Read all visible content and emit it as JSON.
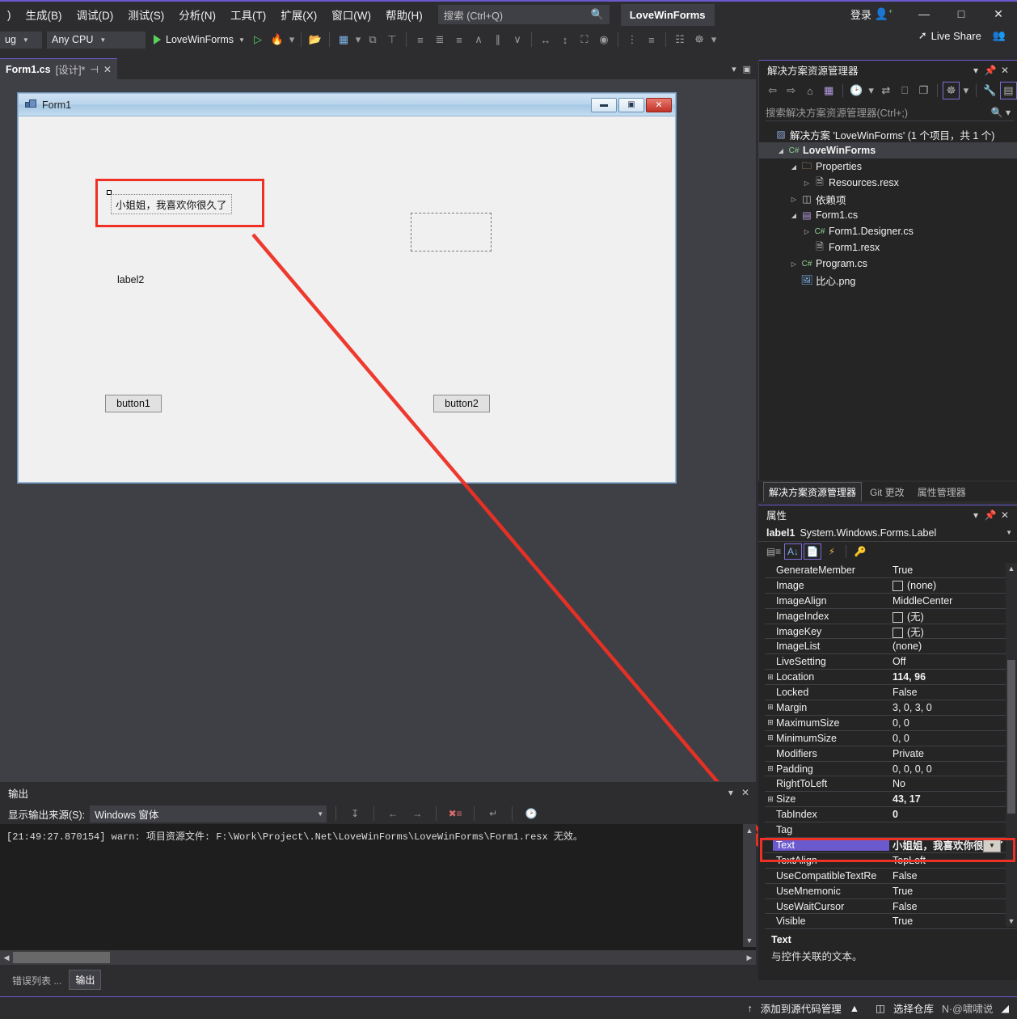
{
  "menubar": {
    "items": [
      {
        "label": ")"
      },
      {
        "label": "生成(B)"
      },
      {
        "label": "调试(D)"
      },
      {
        "label": "测试(S)"
      },
      {
        "label": "分析(N)"
      },
      {
        "label": "工具(T)"
      },
      {
        "label": "扩展(X)"
      },
      {
        "label": "窗口(W)"
      },
      {
        "label": "帮助(H)"
      }
    ],
    "search_placeholder": "搜索 (Ctrl+Q)",
    "project_chip": "LoveWinForms",
    "login_label": "登录",
    "minimize": "—",
    "maximize": "□",
    "close": "✕"
  },
  "toolbar": {
    "config": "ug",
    "platform": "Any CPU",
    "run_target": "LoveWinForms",
    "live_share": "Live Share"
  },
  "document_tab": {
    "name": "Form1.cs",
    "suffix": "[设计]*",
    "pin": "⊣",
    "close": "✕"
  },
  "designer": {
    "form_title": "Form1",
    "minimize": "▬",
    "maximize": "▣",
    "close": "✕",
    "label1_text": "小姐姐，我喜欢你很久了",
    "label2_text": "label2",
    "button1_text": "button1",
    "button2_text": "button2"
  },
  "output": {
    "title": "输出",
    "source_label": "显示输出来源(S):",
    "source_value": "Windows 窗体",
    "line": "[21:49:27.870154] warn: 项目资源文件: F:\\Work\\Project\\.Net\\LoveWinForms\\LoveWinForms\\Form1.resx 无效。",
    "tabs": [
      {
        "label": "错误列表 ...",
        "active": false
      },
      {
        "label": "输出",
        "active": true
      }
    ]
  },
  "solution_explorer": {
    "title": "解决方案资源管理器",
    "search_placeholder": "搜索解决方案资源管理器(Ctrl+;)",
    "tree": [
      {
        "label": "解决方案 'LoveWinForms' (1 个项目，共 1 个)",
        "indent": 0,
        "twisty": "",
        "icon": "▨",
        "icon_color": "#8ba7d6",
        "bold": false,
        "selected": false
      },
      {
        "label": "LoveWinForms",
        "indent": 1,
        "twisty": "◢",
        "icon": "C#",
        "icon_color": "#8fd18f",
        "bold": true,
        "selected": true
      },
      {
        "label": "Properties",
        "indent": 2,
        "twisty": "◢",
        "icon": "🗀",
        "icon_color": "#dcb67a",
        "bold": false,
        "selected": false
      },
      {
        "label": "Resources.resx",
        "indent": 3,
        "twisty": "▷",
        "icon": "🗎",
        "icon_color": "#c8c8c8",
        "bold": false,
        "selected": false
      },
      {
        "label": "依赖项",
        "indent": 2,
        "twisty": "▷",
        "icon": "◫",
        "icon_color": "#c8c8c8",
        "bold": false,
        "selected": false
      },
      {
        "label": "Form1.cs",
        "indent": 2,
        "twisty": "◢",
        "icon": "▤",
        "icon_color": "#b69ae0",
        "bold": false,
        "selected": false
      },
      {
        "label": "Form1.Designer.cs",
        "indent": 3,
        "twisty": "▷",
        "icon": "C#",
        "icon_color": "#8fd18f",
        "bold": false,
        "selected": false
      },
      {
        "label": "Form1.resx",
        "indent": 3,
        "twisty": "",
        "icon": "🗎",
        "icon_color": "#c8c8c8",
        "bold": false,
        "selected": false
      },
      {
        "label": "Program.cs",
        "indent": 2,
        "twisty": "▷",
        "icon": "C#",
        "icon_color": "#8fd18f",
        "bold": false,
        "selected": false
      },
      {
        "label": "比心.png",
        "indent": 2,
        "twisty": "",
        "icon": "🖼",
        "icon_color": "#7fb2e5",
        "bold": false,
        "selected": false
      }
    ],
    "bottom_tabs": [
      {
        "label": "解决方案资源管理器",
        "active": true
      },
      {
        "label": "Git 更改",
        "active": false
      },
      {
        "label": "属性管理器",
        "active": false
      }
    ]
  },
  "properties": {
    "title": "属性",
    "object_name": "label1",
    "object_type": "System.Windows.Forms.Label",
    "rows": [
      {
        "expand": "",
        "key": "GenerateMember",
        "value": "True",
        "bold": false,
        "swatch": false,
        "selected": false
      },
      {
        "expand": "",
        "key": "Image",
        "value": "(none)",
        "bold": false,
        "swatch": true,
        "selected": false
      },
      {
        "expand": "",
        "key": "ImageAlign",
        "value": "MiddleCenter",
        "bold": false,
        "swatch": false,
        "selected": false
      },
      {
        "expand": "",
        "key": "ImageIndex",
        "value": "(无)",
        "bold": false,
        "swatch": true,
        "selected": false
      },
      {
        "expand": "",
        "key": "ImageKey",
        "value": "(无)",
        "bold": false,
        "swatch": true,
        "selected": false
      },
      {
        "expand": "",
        "key": "ImageList",
        "value": "(none)",
        "bold": false,
        "swatch": false,
        "selected": false
      },
      {
        "expand": "",
        "key": "LiveSetting",
        "value": "Off",
        "bold": false,
        "swatch": false,
        "selected": false
      },
      {
        "expand": "⊞",
        "key": "Location",
        "value": "114, 96",
        "bold": true,
        "swatch": false,
        "selected": false
      },
      {
        "expand": "",
        "key": "Locked",
        "value": "False",
        "bold": false,
        "swatch": false,
        "selected": false
      },
      {
        "expand": "⊞",
        "key": "Margin",
        "value": "3, 0, 3, 0",
        "bold": false,
        "swatch": false,
        "selected": false
      },
      {
        "expand": "⊞",
        "key": "MaximumSize",
        "value": "0, 0",
        "bold": false,
        "swatch": false,
        "selected": false
      },
      {
        "expand": "⊞",
        "key": "MinimumSize",
        "value": "0, 0",
        "bold": false,
        "swatch": false,
        "selected": false
      },
      {
        "expand": "",
        "key": "Modifiers",
        "value": "Private",
        "bold": false,
        "swatch": false,
        "selected": false
      },
      {
        "expand": "⊞",
        "key": "Padding",
        "value": "0, 0, 0, 0",
        "bold": false,
        "swatch": false,
        "selected": false
      },
      {
        "expand": "",
        "key": "RightToLeft",
        "value": "No",
        "bold": false,
        "swatch": false,
        "selected": false
      },
      {
        "expand": "⊞",
        "key": "Size",
        "value": "43, 17",
        "bold": true,
        "swatch": false,
        "selected": false
      },
      {
        "expand": "",
        "key": "TabIndex",
        "value": "0",
        "bold": true,
        "swatch": false,
        "selected": false
      },
      {
        "expand": "",
        "key": "Tag",
        "value": "",
        "bold": false,
        "swatch": false,
        "selected": false
      },
      {
        "expand": "",
        "key": "Text",
        "value": "小姐姐，我喜欢你很久了",
        "bold": true,
        "swatch": false,
        "selected": true
      },
      {
        "expand": "",
        "key": "TextAlign",
        "value": "TopLeft",
        "bold": false,
        "swatch": false,
        "selected": false
      },
      {
        "expand": "",
        "key": "UseCompatibleTextRe",
        "value": "False",
        "bold": false,
        "swatch": false,
        "selected": false
      },
      {
        "expand": "",
        "key": "UseMnemonic",
        "value": "True",
        "bold": false,
        "swatch": false,
        "selected": false
      },
      {
        "expand": "",
        "key": "UseWaitCursor",
        "value": "False",
        "bold": false,
        "swatch": false,
        "selected": false
      },
      {
        "expand": "",
        "key": "Visible",
        "value": "True",
        "bold": false,
        "swatch": false,
        "selected": false
      }
    ],
    "desc_title": "Text",
    "desc_body": "与控件关联的文本。"
  },
  "statusbar": {
    "source_control": "添加到源代码管理",
    "repo": "选择仓库",
    "watermark": "N·@啸啸说"
  },
  "colors": {
    "accent_purple": "#6a5acd",
    "highlight_red": "#ee3124",
    "chrome_bg": "#2d2d30",
    "panel_bg": "#252526",
    "editor_bg": "#1e1e1e"
  }
}
